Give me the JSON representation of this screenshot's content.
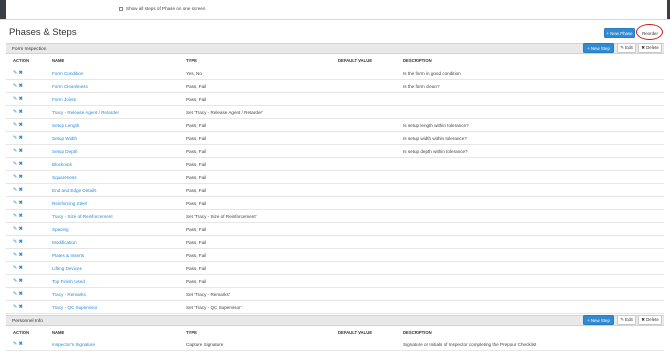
{
  "top": {
    "show_all_label": "Show all steps of Phase on one screen"
  },
  "page": {
    "title": "Phases & Steps",
    "new_phase_label": "+ New Phase",
    "reorder_label": "Reorder"
  },
  "columns": {
    "action": "ACTION",
    "name": "NAME",
    "type": "TYPE",
    "default": "DEFAULT VALUE",
    "description": "DESCRIPTION"
  },
  "sections": [
    {
      "title": "Form Inspection",
      "new_step_label": "+ New Step",
      "edit_label": "✎ Edit",
      "delete_label": "✖ Delete",
      "rows": [
        {
          "name": "Form Condition",
          "type": "Yes, No",
          "description": "Is the form in good condition"
        },
        {
          "name": "Form Cleanliness",
          "type": "Pass, Fail",
          "description": "Is the form clean?"
        },
        {
          "name": "Form Joints",
          "type": "Pass, Fail",
          "description": ""
        },
        {
          "name": "Tracy - Release Agent / Retarder",
          "type": "Set 'Tracy - Release Agent / Retarder'",
          "description": ""
        },
        {
          "name": "Setup Length",
          "type": "Pass, Fail",
          "description": "Is setup length within tolerance?"
        },
        {
          "name": "Setup Width",
          "type": "Pass, Fail",
          "description": "Is setup width within tolerance?"
        },
        {
          "name": "Setup Depth",
          "type": "Pass, Fail",
          "description": "Is setup depth within tolerance?"
        },
        {
          "name": "Blockouts",
          "type": "Pass, Fail",
          "description": ""
        },
        {
          "name": "Squareness",
          "type": "Pass, Fail",
          "description": ""
        },
        {
          "name": "End and Edge Details",
          "type": "Pass, Fail",
          "description": ""
        },
        {
          "name": "Reinforcing Steel",
          "type": "Pass, Fail",
          "description": ""
        },
        {
          "name": "Tracy - Size of Reinforcement",
          "type": "Set 'Tracy - Size of Reinforcement'",
          "description": ""
        },
        {
          "name": "Spacing",
          "type": "Pass, Fail",
          "description": ""
        },
        {
          "name": "Modification",
          "type": "Pass, Fail",
          "description": ""
        },
        {
          "name": "Plates & Inserts",
          "type": "Pass, Fail",
          "description": ""
        },
        {
          "name": "Lifting Devices",
          "type": "Pass, Fail",
          "description": ""
        },
        {
          "name": "Top Finish Used",
          "type": "Pass, Fail",
          "description": ""
        },
        {
          "name": "Tracy - Remarks",
          "type": "Set 'Tracy - Remarks'",
          "description": ""
        },
        {
          "name": "Tracy - QC Supervisor",
          "type": "Set 'Tracy - QC Supervisor'",
          "description": ""
        }
      ]
    },
    {
      "title": "Personnel Info",
      "new_step_label": "+ New Step",
      "edit_label": "✎ Edit",
      "delete_label": "✖ Delete",
      "rows": [
        {
          "name": "Inspector's Signature",
          "type": "Capture Signature",
          "description": "Signature or Initials of Inspector completing the Prepour Checklist"
        }
      ]
    }
  ],
  "colors": {
    "accent": "#2e8bd4",
    "highlight_ring": "#cc1f1f",
    "section_bg": "#e9e9e9"
  }
}
